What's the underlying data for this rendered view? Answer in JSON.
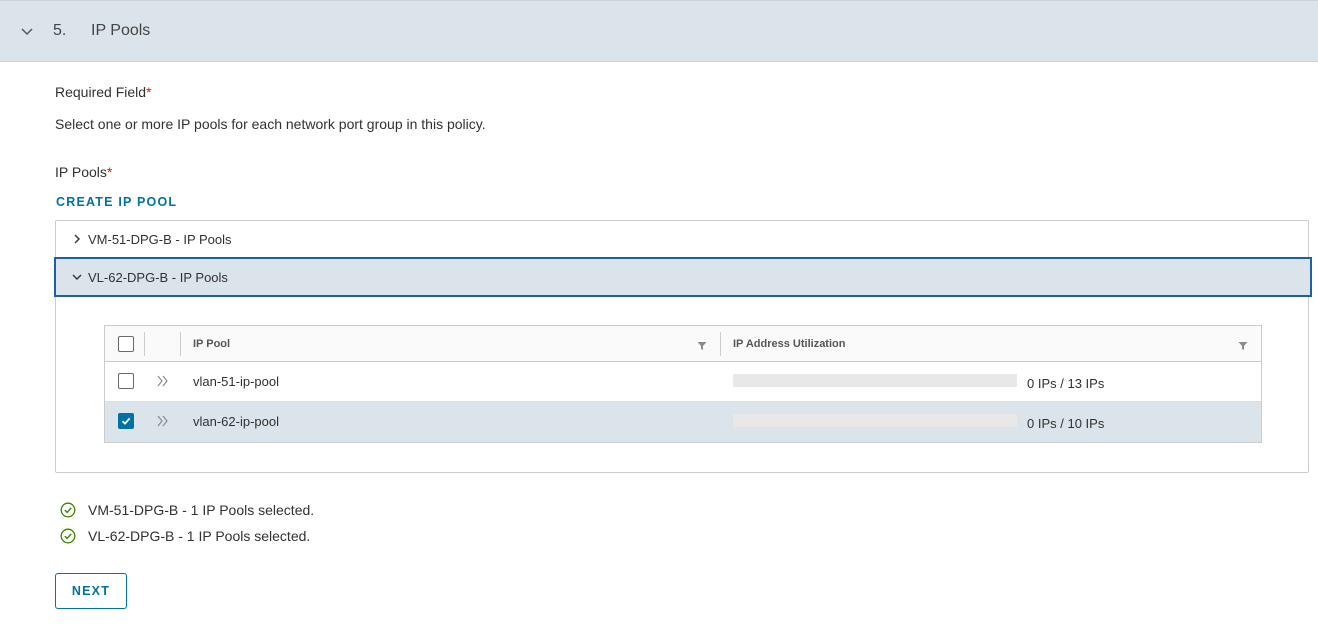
{
  "step": {
    "number": "5.",
    "title": "IP Pools"
  },
  "form": {
    "required_label": "Required Field",
    "required_star": "*",
    "description": "Select one or more IP pools for each network port group in this policy.",
    "pools_label": "IP Pools",
    "pools_star": "*",
    "create_link": "CREATE IP POOL"
  },
  "accordion": [
    {
      "label": "VM-51-DPG-B - IP Pools",
      "expanded": false
    },
    {
      "label": "VL-62-DPG-B - IP Pools",
      "expanded": true
    }
  ],
  "grid": {
    "columns": [
      "IP Pool",
      "IP Address Utilization"
    ],
    "rows": [
      {
        "name": "vlan-51-ip-pool",
        "utilization": "0 IPs / 13 IPs",
        "used_fraction": 0,
        "checked": false
      },
      {
        "name": "vlan-62-ip-pool",
        "utilization": "0 IPs / 10 IPs",
        "used_fraction": 0,
        "checked": true
      }
    ]
  },
  "status": [
    "VM-51-DPG-B - 1 IP Pools selected.",
    "VL-62-DPG-B - 1 IP Pools selected."
  ],
  "buttons": {
    "next": "NEXT"
  },
  "colors": {
    "accent": "#0072a3",
    "header_bg": "#dbe4ea",
    "selected_border": "#1f5fa8",
    "success": "#3c8500",
    "required": "#c92100"
  }
}
